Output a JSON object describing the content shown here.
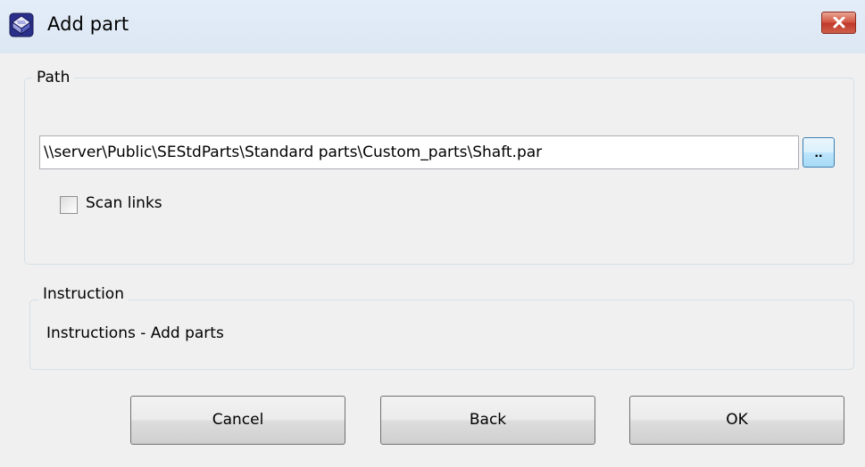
{
  "window": {
    "title": "Add part",
    "icon": "book-icon",
    "close": "close-icon"
  },
  "path_group": {
    "legend": "Path",
    "path_value": "\\\\server\\Public\\SEStdParts\\Standard parts\\Custom_parts\\Shaft.par",
    "browse_label": "..",
    "scan_links": {
      "label": "Scan links",
      "checked": false
    }
  },
  "instruction_group": {
    "legend": "Instruction",
    "text": "Instructions - Add parts"
  },
  "buttons": {
    "cancel": "Cancel",
    "back": "Back",
    "ok": "OK"
  },
  "colors": {
    "close_button": "#c0382a",
    "browse_button": "#a7d9f5",
    "titlebar": "#dce7f4"
  }
}
